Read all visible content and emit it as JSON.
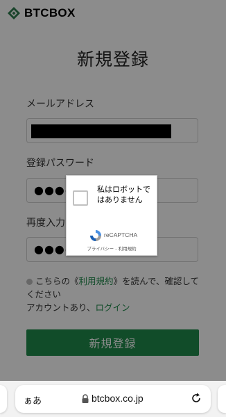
{
  "header": {
    "logo_text": "BTCBOX",
    "menu_icon": "hamburger-menu-icon"
  },
  "page": {
    "title": "新規登録"
  },
  "form": {
    "email_label": "メールアドレス",
    "password_label": "登録パスワード",
    "password_value": "●●●●",
    "confirm_label": "再度入力",
    "confirm_value": "●●●●",
    "agree_prefix": "こちらの《",
    "agree_link": "利用規約",
    "agree_suffix": "》を読んで、確認してください",
    "account_text": "アカウントあり、",
    "login_link": "ログイン",
    "submit_label": "新規登録"
  },
  "recaptcha": {
    "prompt": "私はロボットではありません",
    "brand": "reCAPTCHA",
    "footer": "プライバシー - 利用規約"
  },
  "browser": {
    "text_size": "ぁあ",
    "url": "btcbox.co.jp"
  },
  "colors": {
    "accent": "#1f8a4c",
    "overlay": "rgba(0,0,0,0.45)"
  }
}
